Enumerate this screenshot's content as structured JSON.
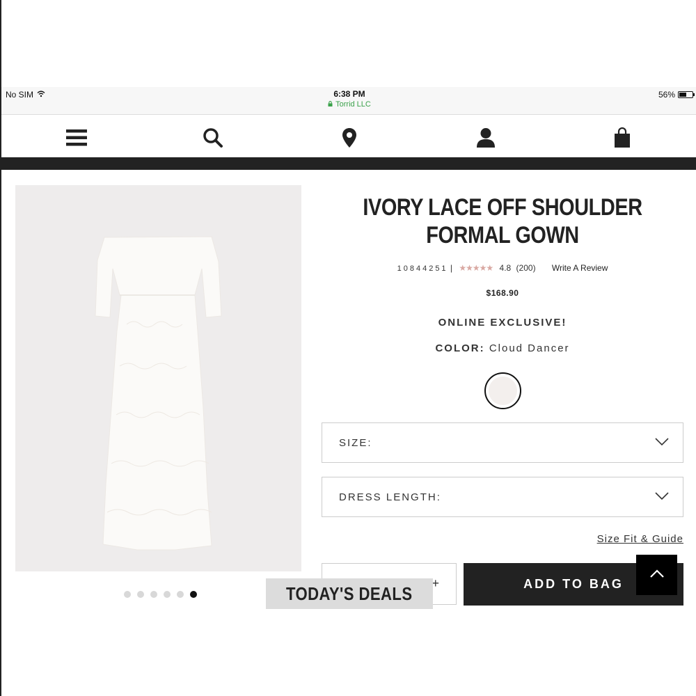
{
  "status_bar": {
    "carrier": "No SIM",
    "time": "6:38 PM",
    "url": "Torrid LLC",
    "battery": "56%",
    "battery_level": 0.56
  },
  "nav": {
    "icons": [
      "menu-icon",
      "search-icon",
      "location-pin-icon",
      "account-icon",
      "shopping-bag-icon"
    ]
  },
  "product": {
    "title": "IVORY LACE OFF SHOULDER FORMAL GOWN",
    "sku": "10844251",
    "separator": "|",
    "stars": "★★★★★",
    "rating": "4.8",
    "review_count": "(200)",
    "write_review": "Write A Review",
    "price": "$168.90",
    "exclusive": "ONLINE EXCLUSIVE!",
    "color_label": "COLOR:",
    "color_value": "Cloud Dancer",
    "swatch_color": "#f3efed",
    "image_count": 6,
    "active_image": 6
  },
  "selectors": {
    "size_label": "SIZE:",
    "dress_length_label": "DRESS LENGTH:"
  },
  "links": {
    "size_guide": "Size Fit & Guide"
  },
  "cart": {
    "qty_plus": "+",
    "add_to_bag": "ADD TO BAG"
  },
  "overlay": {
    "todays_deals": "TODAY'S DEALS"
  },
  "colors": {
    "dark": "#222222",
    "star": "#d9a8a2",
    "secure_green": "#3aa14a"
  }
}
